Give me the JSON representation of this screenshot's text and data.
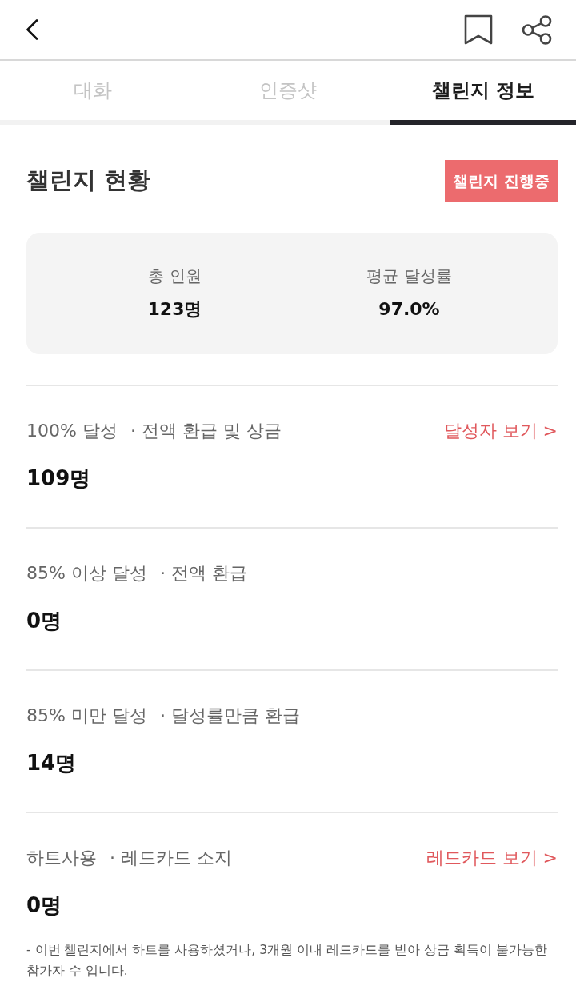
{
  "tabs": [
    {
      "label": "대화",
      "selected": false
    },
    {
      "label": "인증샷",
      "selected": false
    },
    {
      "label": "챌린지 정보",
      "selected": true
    }
  ],
  "status": {
    "title": "챌린지 현황",
    "badge": "챌린지 진행중"
  },
  "summary": [
    {
      "label": "총 인원",
      "value": "123명"
    },
    {
      "label": "평균 달성률",
      "value": "97.0%"
    }
  ],
  "groups": [
    {
      "condition": "100% 달성",
      "benefit": "· 전액 환급 및 상금",
      "count": "109명",
      "link": "달성자 보기 >"
    },
    {
      "condition": "85% 이상 달성",
      "benefit": "· 전액 환급",
      "count": "0명"
    },
    {
      "condition": "85% 미만 달성",
      "benefit": "· 달성률만큼 환급",
      "count": "14명"
    },
    {
      "condition": "하트사용",
      "benefit": "· 레드카드 소지",
      "count": "0명",
      "link": "레드카드 보기 >",
      "note": "- 이번 챌린지에서 하트를 사용하셨거나, 3개월 이내 레드카드를 받아 상금 획득이 불가능한 참가자 수 입니다."
    }
  ]
}
